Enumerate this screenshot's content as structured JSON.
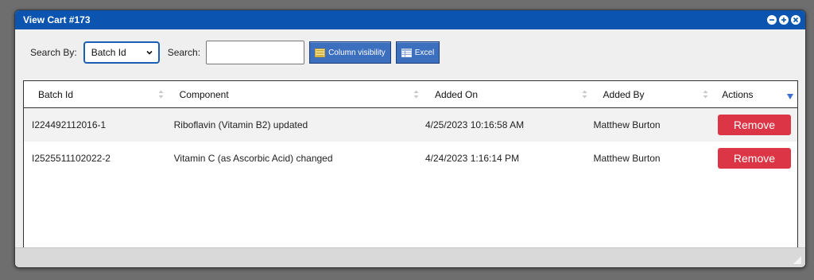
{
  "window": {
    "title": "View Cart #173",
    "controls": [
      "minimize-icon",
      "maximize-icon",
      "close-icon"
    ]
  },
  "toolbar": {
    "search_by_label": "Search By:",
    "search_by_value": "Batch Id",
    "search_label": "Search:",
    "search_value": "",
    "column_visibility_label": "Column visibility",
    "excel_label": "Excel"
  },
  "table": {
    "headers": [
      "Batch Id",
      "Component",
      "Added On",
      "Added By",
      "Actions"
    ],
    "rows": [
      {
        "batch_id": "I224492112016-1",
        "component": "Riboflavin (Vitamin B2) updated",
        "added_on": "4/25/2023 10:16:58 AM",
        "added_by": "Matthew Burton",
        "action": "Remove"
      },
      {
        "batch_id": "I2525511102022-2",
        "component": "Vitamin C (as Ascorbic Acid) changed",
        "added_on": "4/24/2023 1:16:14 PM",
        "added_by": "Matthew Burton",
        "action": "Remove"
      }
    ]
  },
  "colors": {
    "titlebar": "#0b55b0",
    "button": "#3d6fbf",
    "remove": "#dc3545"
  }
}
